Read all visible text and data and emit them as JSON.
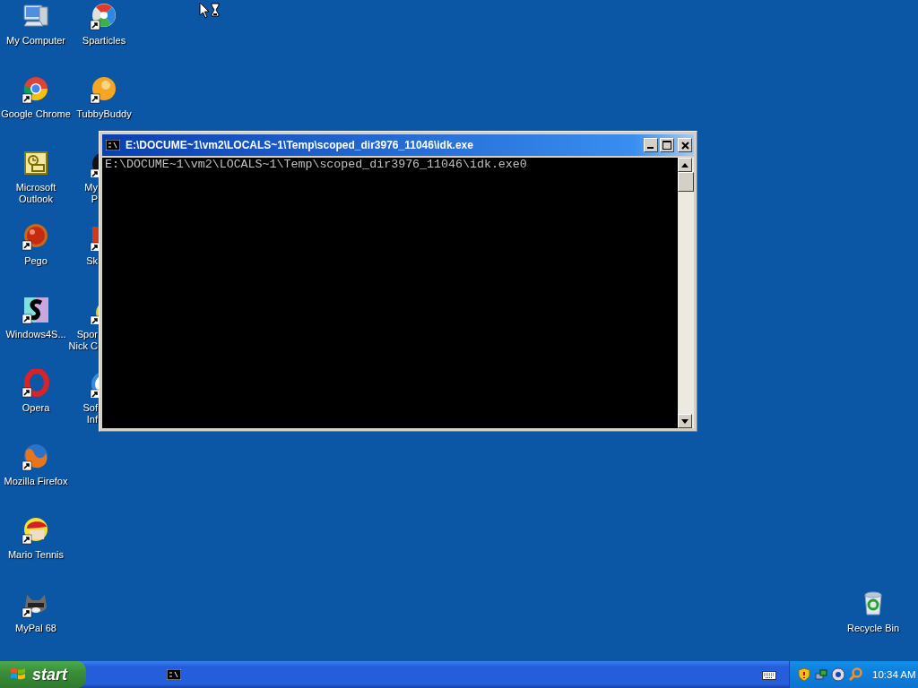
{
  "desktop_icons": [
    {
      "label_lines": [
        "My Computer"
      ],
      "shortcut": false,
      "cut": false
    },
    {
      "label_lines": [
        "Google Chrome"
      ],
      "shortcut": true,
      "cut": false
    },
    {
      "label_lines": [
        "Microsoft",
        "Outlook"
      ],
      "shortcut": false,
      "cut": false
    },
    {
      "label_lines": [
        "Pego"
      ],
      "shortcut": true,
      "cut": false
    },
    {
      "label_lines": [
        "Windows4S..."
      ],
      "shortcut": true,
      "cut": false
    },
    {
      "label_lines": [
        "Opera"
      ],
      "shortcut": true,
      "cut": false
    },
    {
      "label_lines": [
        "Mozilla Firefox"
      ],
      "shortcut": true,
      "cut": false
    },
    {
      "label_lines": [
        "Mario Tennis"
      ],
      "shortcut": true,
      "cut": false
    },
    {
      "label_lines": [
        "MyPal 68"
      ],
      "shortcut": true,
      "cut": false
    }
  ],
  "desktop_icons_2": [
    {
      "label_lines": [
        "Sparticles"
      ],
      "shortcut": true,
      "cut": false
    },
    {
      "label_lines": [
        "TubbyBuddy"
      ],
      "shortcut": true,
      "cut": false
    },
    {
      "label_lines": [
        "My",
        "P"
      ],
      "shortcut": true,
      "cut": true
    },
    {
      "label_lines": [
        "Sk"
      ],
      "shortcut": true,
      "cut": true
    },
    {
      "label_lines": [
        "Spor",
        "Nick C"
      ],
      "shortcut": true,
      "cut": true
    },
    {
      "label_lines": [
        "Sof",
        "Inf"
      ],
      "shortcut": true,
      "cut": true
    }
  ],
  "recycle_bin": {
    "label_lines": [
      "Recycle Bin"
    ]
  },
  "window": {
    "title": "E:\\DOCUME~1\\vm2\\LOCALS~1\\Temp\\scoped_dir3976_11046\\idk.exe",
    "console_lines": [
      "E:\\DOCUME~1\\vm2\\LOCALS~1\\Temp\\scoped_dir3976_11046\\idk.exe0"
    ]
  },
  "taskbar": {
    "start_label": "start",
    "clock": "10:34 AM"
  }
}
